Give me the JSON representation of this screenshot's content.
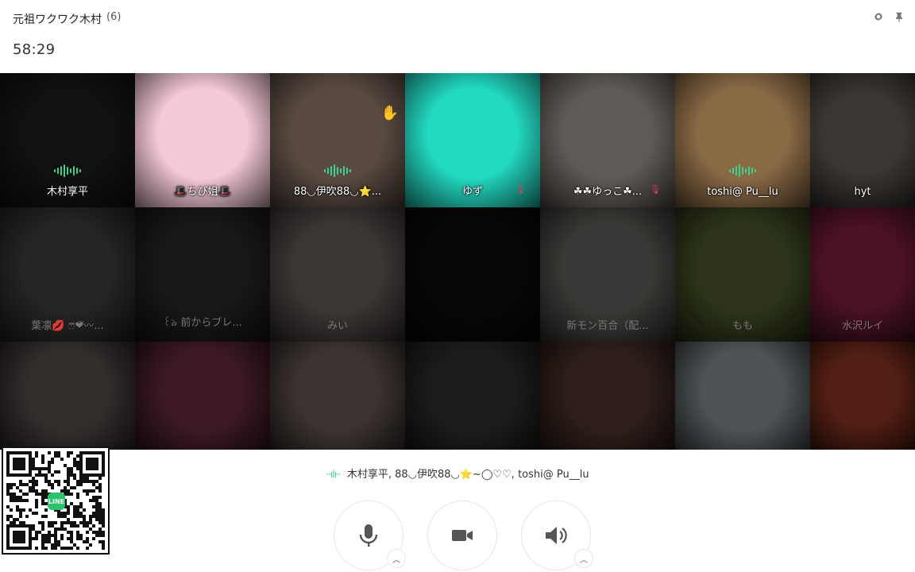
{
  "header": {
    "room_name": "元祖ワクワク木村",
    "member_count": "(6)",
    "timer": "58:29",
    "settings_icon": "gear-icon",
    "pin_icon": "pin-icon"
  },
  "tiles": [
    {
      "name": "木村享平",
      "speaking": true,
      "muted": false,
      "dim": false,
      "bg": "#111111"
    },
    {
      "name": "🎩ちび姐🎩",
      "speaking": false,
      "muted": false,
      "dim": false,
      "bg": "#f5c9d6"
    },
    {
      "name": "88◡伊吹88◡⭐...",
      "speaking": true,
      "muted": false,
      "dim": false,
      "bg": "#5a4b42",
      "hand": true
    },
    {
      "name": "ゆず",
      "speaking": false,
      "muted": true,
      "dim": false,
      "bg": "#22d9c2"
    },
    {
      "name": "☘☘ゆっこ☘...",
      "speaking": false,
      "muted": true,
      "dim": false,
      "bg": "#5f5a55"
    },
    {
      "name": "toshi@ Pu__lu",
      "speaking": true,
      "muted": false,
      "dim": false,
      "bg": "#8a6a45"
    },
    {
      "name": "hyt",
      "speaking": false,
      "muted": false,
      "dim": false,
      "bg": "#3a3632"
    },
    {
      "name": "葉凛💋 ෆ⃛❤︎⃛〰...",
      "dim": true,
      "bg": "#5a5855"
    },
    {
      "name": "꒰ঌ 前からブレ...",
      "dim": true,
      "bg": "#3b3838"
    },
    {
      "name": "みい",
      "dim": true,
      "bg": "#8d7f7c"
    },
    {
      "name": "",
      "dim": true,
      "bg": "#111111"
    },
    {
      "name": "新モン百合（配...",
      "dim": true,
      "bg": "#8b8680"
    },
    {
      "name": "もも",
      "dim": true,
      "bg": "#6b7d3c"
    },
    {
      "name": "水沢ルイ",
      "dim": true,
      "bg": "#b32a5c"
    },
    {
      "name": "",
      "dim": true,
      "bg": "#7a6b6a"
    },
    {
      "name": "",
      "dim": true,
      "bg": "#8e3b57"
    },
    {
      "name": "",
      "dim": true,
      "bg": "#8f7b76"
    },
    {
      "name": "",
      "dim": true,
      "bg": "#444444"
    },
    {
      "name": "",
      "dim": true,
      "bg": "#6e4a3e"
    },
    {
      "name": "",
      "dim": true,
      "bg": "#b9c6cc"
    },
    {
      "name": "",
      "dim": true,
      "bg": "#c24a2e"
    }
  ],
  "speaking_bar": {
    "icon": "sound-wave-icon",
    "text": "木村享平, 88◡伊吹88◡⭐~◯♡♡, toshi@ Pu__lu"
  },
  "controls": {
    "mic_icon": "microphone-icon",
    "camera_icon": "video-camera-icon",
    "speaker_icon": "speaker-icon",
    "caret_icon": "chevron-up-icon"
  },
  "qr": {
    "logo_text": "LINE"
  }
}
